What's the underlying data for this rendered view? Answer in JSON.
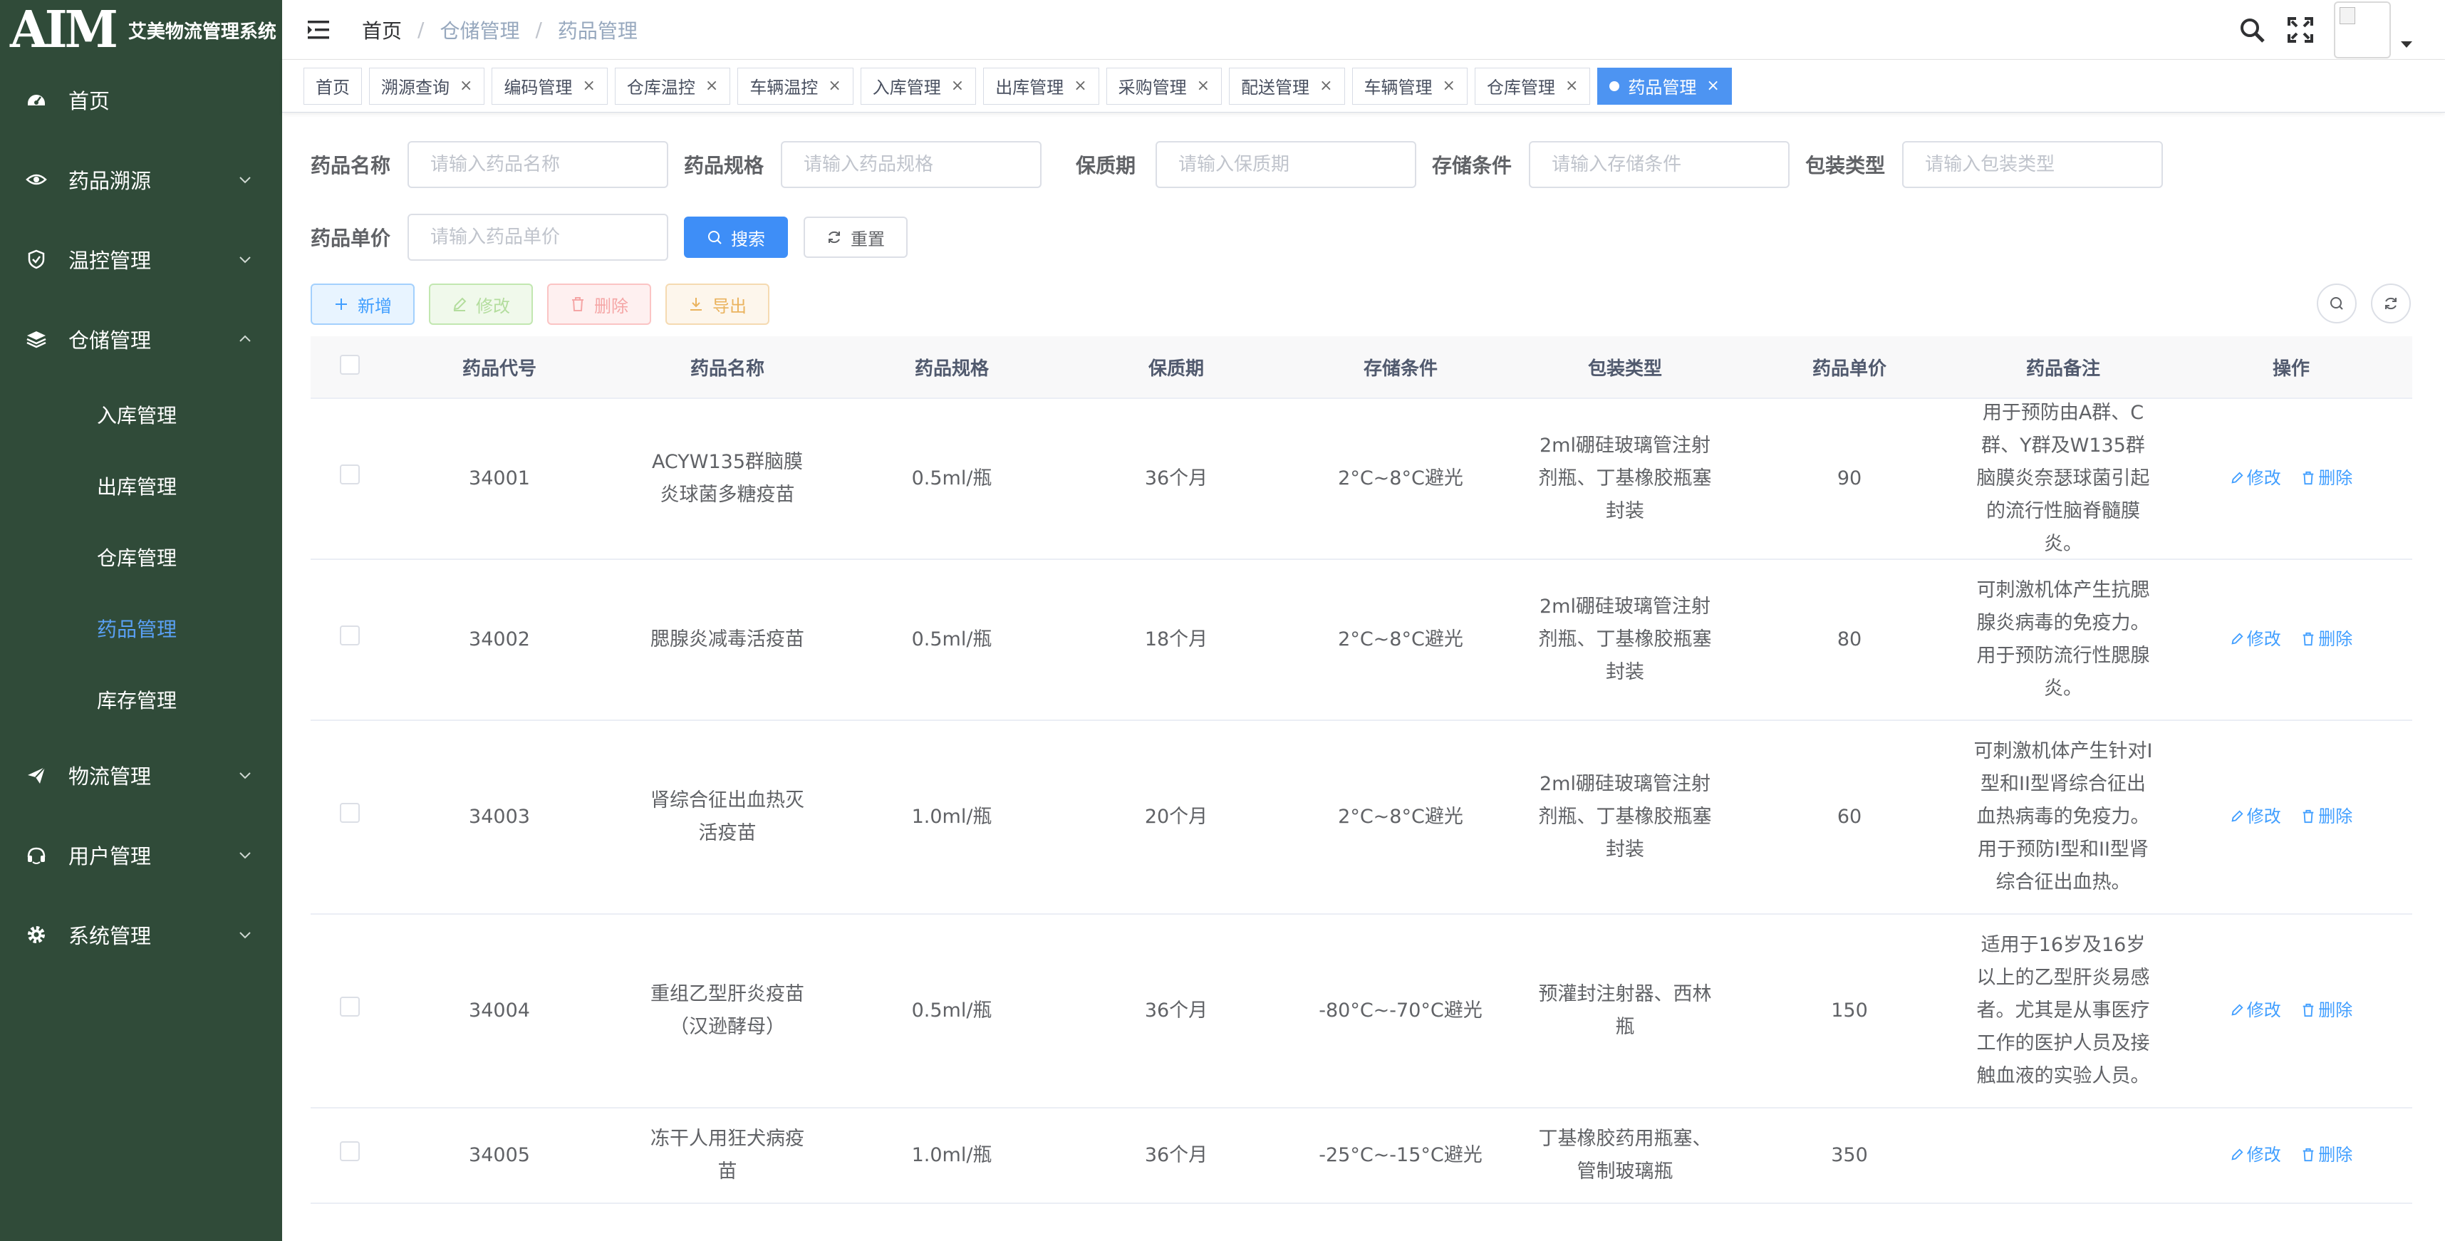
{
  "brand": {
    "logo_text": "AIM",
    "title": "艾美物流管理系统"
  },
  "sidebar": {
    "items": [
      {
        "label": "首页",
        "icon": "dashboard-icon",
        "expandable": false
      },
      {
        "label": "药品溯源",
        "icon": "eye-icon",
        "expandable": true
      },
      {
        "label": "温控管理",
        "icon": "shield-icon",
        "expandable": true
      },
      {
        "label": "仓储管理",
        "icon": "layers-icon",
        "expandable": true,
        "expanded": true
      },
      {
        "label": "物流管理",
        "icon": "send-icon",
        "expandable": true
      },
      {
        "label": "用户管理",
        "icon": "user-icon",
        "expandable": true
      },
      {
        "label": "系统管理",
        "icon": "gear-icon",
        "expandable": true
      }
    ],
    "submenu": [
      {
        "label": "入库管理",
        "active": false
      },
      {
        "label": "出库管理",
        "active": false
      },
      {
        "label": "仓库管理",
        "active": false
      },
      {
        "label": "药品管理",
        "active": true
      },
      {
        "label": "库存管理",
        "active": false
      }
    ],
    "active_color": "#5aa0f5",
    "background": "#304b39"
  },
  "header": {
    "breadcrumb": [
      "首页",
      "仓储管理",
      "药品管理"
    ],
    "separator": "/"
  },
  "tags": [
    {
      "label": "首页",
      "closable": false,
      "active": false
    },
    {
      "label": "溯源查询",
      "closable": true,
      "active": false
    },
    {
      "label": "编码管理",
      "closable": true,
      "active": false
    },
    {
      "label": "仓库温控",
      "closable": true,
      "active": false
    },
    {
      "label": "车辆温控",
      "closable": true,
      "active": false
    },
    {
      "label": "入库管理",
      "closable": true,
      "active": false
    },
    {
      "label": "出库管理",
      "closable": true,
      "active": false
    },
    {
      "label": "采购管理",
      "closable": true,
      "active": false
    },
    {
      "label": "配送管理",
      "closable": true,
      "active": false
    },
    {
      "label": "车辆管理",
      "closable": true,
      "active": false
    },
    {
      "label": "仓库管理",
      "closable": true,
      "active": false
    },
    {
      "label": "药品管理",
      "closable": true,
      "active": true
    }
  ],
  "search": {
    "fields": [
      {
        "label": "药品名称",
        "placeholder": "请输入药品名称",
        "value": ""
      },
      {
        "label": "药品规格",
        "placeholder": "请输入药品规格",
        "value": ""
      },
      {
        "label": "保质期",
        "placeholder": "请输入保质期",
        "value": ""
      },
      {
        "label": "存储条件",
        "placeholder": "请输入存储条件",
        "value": ""
      },
      {
        "label": "包装类型",
        "placeholder": "请输入包装类型",
        "value": ""
      },
      {
        "label": "药品单价",
        "placeholder": "请输入药品单价",
        "value": ""
      }
    ],
    "search_label": "搜索",
    "reset_label": "重置"
  },
  "toolbar": {
    "add_label": "新增",
    "edit_label": "修改",
    "delete_label": "删除",
    "export_label": "导出"
  },
  "table": {
    "columns": [
      "药品代号",
      "药品名称",
      "药品规格",
      "保质期",
      "存储条件",
      "包装类型",
      "药品单价",
      "药品备注",
      "操作"
    ],
    "row_action_edit": "修改",
    "row_action_delete": "删除",
    "rows": [
      {
        "code": "34001",
        "name": "ACYW135群脑膜炎球菌多糖疫苗",
        "spec": "0.5ml/瓶",
        "shelf": "36个月",
        "storage": "2°C~8°C避光",
        "pack": "2ml硼硅玻璃管注射剂瓶、丁基橡胶瓶塞封装",
        "price": "90",
        "note": "用于预防由A群、C群、Y群及W135群脑膜炎奈瑟球菌引起的流行性脑脊髓膜炎。"
      },
      {
        "code": "34002",
        "name": "腮腺炎减毒活疫苗",
        "spec": "0.5ml/瓶",
        "shelf": "18个月",
        "storage": "2°C~8°C避光",
        "pack": "2ml硼硅玻璃管注射剂瓶、丁基橡胶瓶塞封装",
        "price": "80",
        "note": "可刺激机体产生抗腮腺炎病毒的免疫力。用于预防流行性腮腺炎。"
      },
      {
        "code": "34003",
        "name": "肾综合征出血热灭活疫苗",
        "spec": "1.0ml/瓶",
        "shelf": "20个月",
        "storage": "2°C~8°C避光",
        "pack": "2ml硼硅玻璃管注射剂瓶、丁基橡胶瓶塞封装",
        "price": "60",
        "note": "可刺激机体产生针对I型和II型肾综合征出血热病毒的免疫力。用于预防I型和II型肾综合征出血热。"
      },
      {
        "code": "34004",
        "name": "重组乙型肝炎疫苗（汉逊酵母）",
        "spec": "0.5ml/瓶",
        "shelf": "36个月",
        "storage": "-80°C~-70°C避光",
        "pack": "预灌封注射器、西林瓶",
        "price": "150",
        "note": "适用于16岁及16岁以上的乙型肝炎易感者。尤其是从事医疗工作的医护人员及接触血液的实验人员。"
      },
      {
        "code": "34005",
        "name": "冻干人用狂犬病疫苗",
        "spec": "1.0ml/瓶",
        "shelf": "36个月",
        "storage": "-25°C~-15°C避光",
        "pack": "丁基橡胶药用瓶塞、管制玻璃瓶",
        "price": "350",
        "note": ""
      }
    ]
  }
}
